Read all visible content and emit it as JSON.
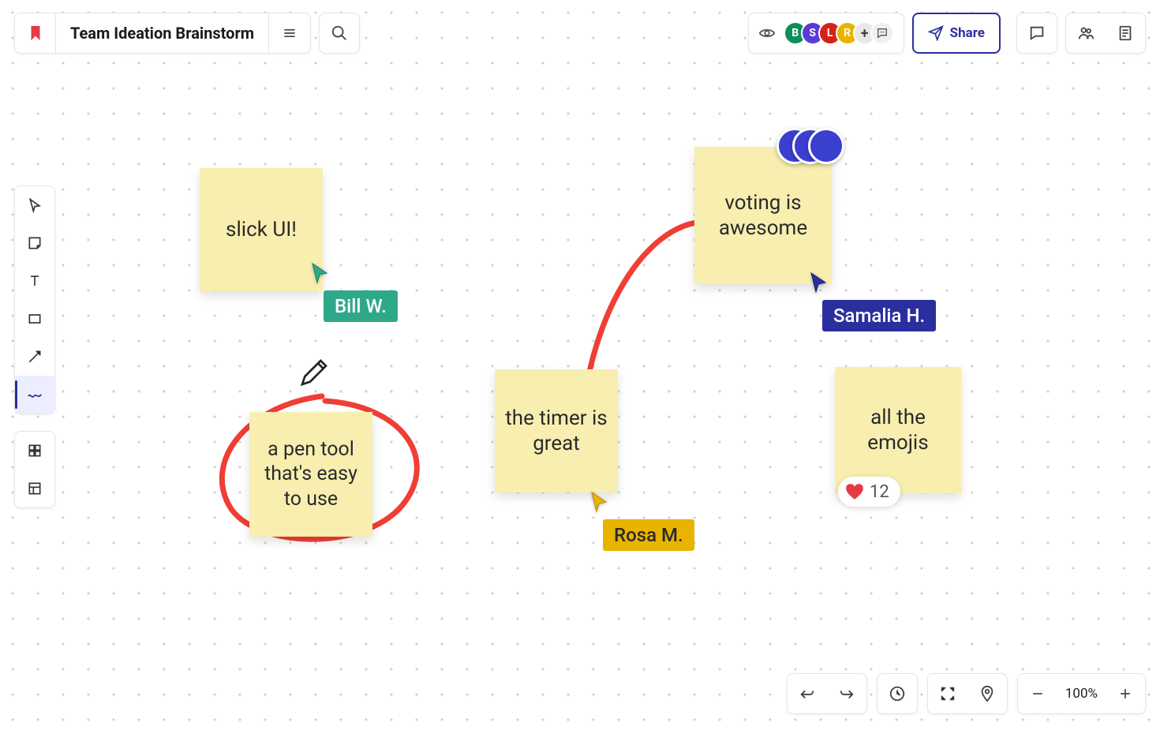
{
  "board": {
    "title": "Team Ideation Brainstorm"
  },
  "share": {
    "label": "Share"
  },
  "zoom": {
    "level": "100%"
  },
  "participants": [
    {
      "initial": "B",
      "color": "#0d8f5b"
    },
    {
      "initial": "S",
      "color": "#5c3ad6"
    },
    {
      "initial": "L",
      "color": "#d6221a"
    },
    {
      "initial": "R",
      "color": "#e8b400"
    }
  ],
  "participants_more": "+",
  "stickies": [
    {
      "id": "s1",
      "text": "slick UI!"
    },
    {
      "id": "s2",
      "text": "a pen tool that's easy to use"
    },
    {
      "id": "s3",
      "text": "the timer is great"
    },
    {
      "id": "s4",
      "text": "voting is awesome"
    },
    {
      "id": "s5",
      "text": "all the emojis"
    }
  ],
  "cursors": [
    {
      "name": "Bill W.",
      "color": "#2fa88a"
    },
    {
      "name": "Rosa M.",
      "color": "#e8b400"
    },
    {
      "name": "Samalia H.",
      "color": "#2b2f9e"
    }
  ],
  "reactions": {
    "heart_count": "12"
  },
  "toolbar": {
    "tools": [
      "select",
      "sticky",
      "text",
      "shape",
      "line",
      "draw"
    ],
    "active": "draw"
  }
}
